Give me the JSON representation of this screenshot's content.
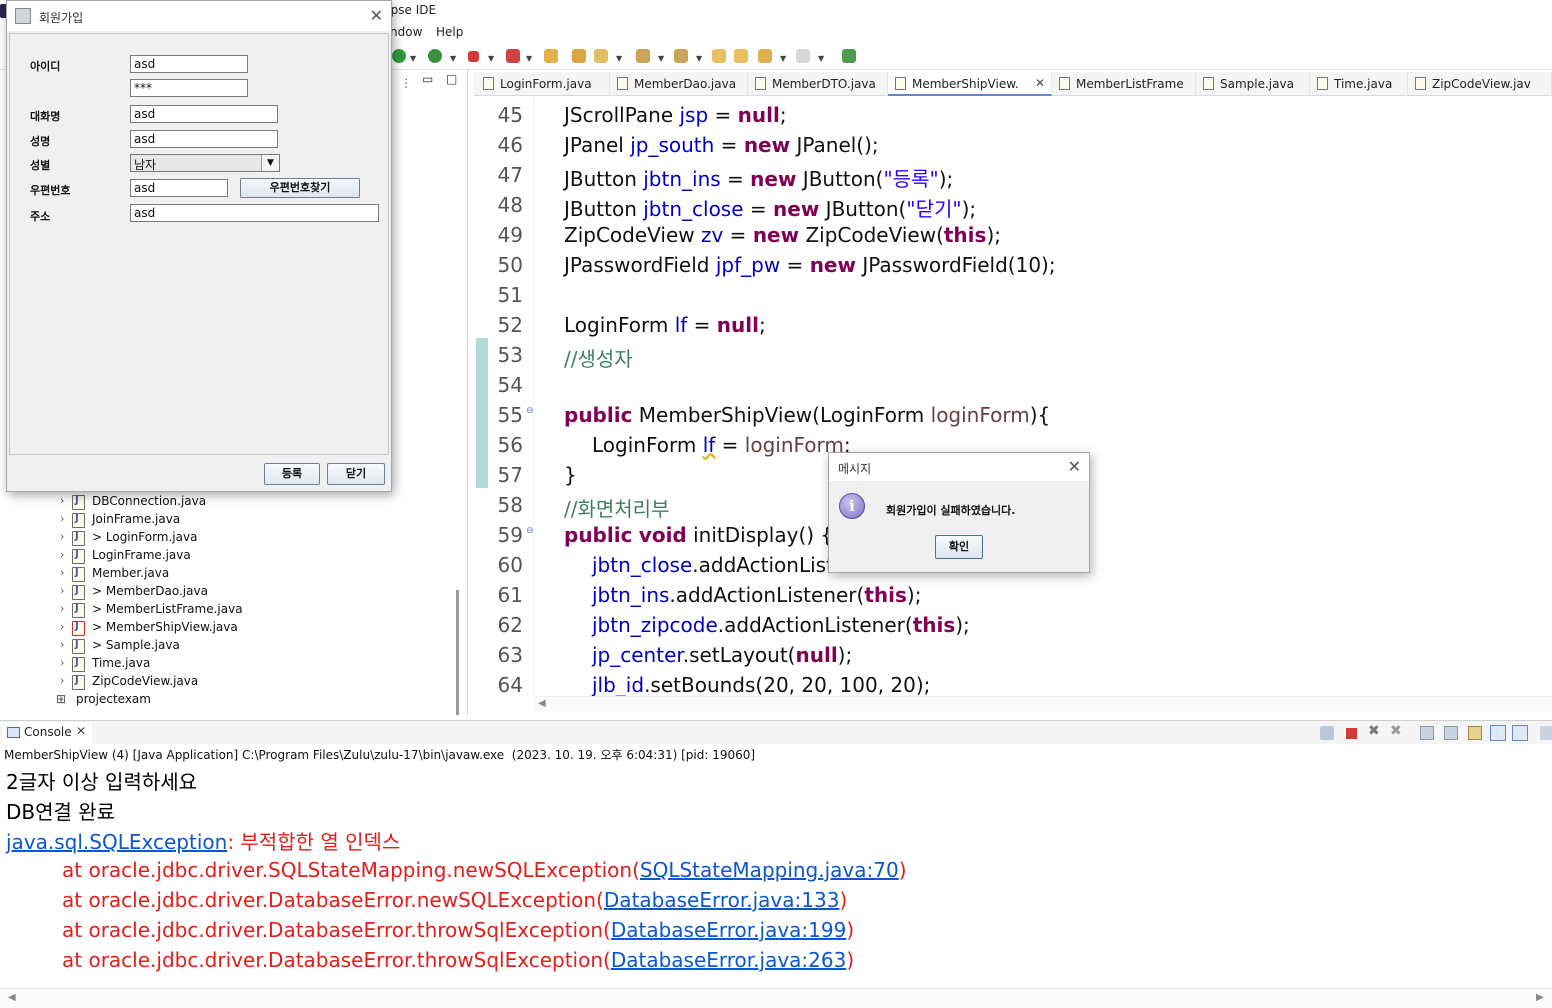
{
  "ide": {
    "title_fragment": "lipse IDE",
    "menu": [
      "ndow",
      "Help"
    ]
  },
  "explorer": {
    "items": [
      {
        "label": "DBConnection.java",
        "prefix": ""
      },
      {
        "label": "JoinFrame.java",
        "prefix": ""
      },
      {
        "label": "LoginForm.java",
        "prefix": "> "
      },
      {
        "label": "LoginFrame.java",
        "prefix": ""
      },
      {
        "label": "Member.java",
        "prefix": ""
      },
      {
        "label": "MemberDao.java",
        "prefix": "> "
      },
      {
        "label": "MemberListFrame.java",
        "prefix": "> "
      },
      {
        "label": "MemberShipView.java",
        "prefix": "> "
      },
      {
        "label": "Sample.java",
        "prefix": "> "
      },
      {
        "label": "Time.java",
        "prefix": ""
      },
      {
        "label": "ZipCodeView.java",
        "prefix": ""
      }
    ],
    "project": "projectexam"
  },
  "editor": {
    "tabs": [
      {
        "label": "LoginForm.java",
        "active": false
      },
      {
        "label": "MemberDao.java",
        "active": false
      },
      {
        "label": "MemberDTO.java",
        "active": false
      },
      {
        "label": "MemberShipView.",
        "active": true
      },
      {
        "label": "MemberListFrame",
        "active": false
      },
      {
        "label": "Sample.java",
        "active": false
      },
      {
        "label": "Time.java",
        "active": false
      },
      {
        "label": "ZipCodeView.jav",
        "active": false
      }
    ],
    "line_numbers": [
      "45",
      "46",
      "47",
      "48",
      "49",
      "50",
      "51",
      "52",
      "53",
      "54",
      "55",
      "56",
      "57",
      "58",
      "59",
      "60",
      "61",
      "62",
      "63",
      "64"
    ],
    "code": {
      "l45a": "JScrollPane ",
      "l45b": "jsp",
      "l45c": " = ",
      "l45d": "null",
      "l45e": ";",
      "l46a": "JPanel ",
      "l46b": "jp_south",
      "l46c": " = ",
      "l46d": "new",
      "l46e": " JPanel();",
      "l47a": "JButton ",
      "l47b": "jbtn_ins",
      "l47c": " = ",
      "l47d": "new",
      "l47e": " JButton(",
      "l47f": "\"등록\"",
      "l47g": ");",
      "l48a": "JButton ",
      "l48b": "jbtn_close",
      "l48c": " = ",
      "l48d": "new",
      "l48e": " JButton(",
      "l48f": "\"닫기\"",
      "l48g": ");",
      "l49a": "ZipCodeView ",
      "l49b": "zv",
      "l49c": " = ",
      "l49d": "new",
      "l49e": " ZipCodeView(",
      "l49f": "this",
      "l49g": ");",
      "l50a": "JPasswordField ",
      "l50b": "jpf_pw",
      "l50c": " = ",
      "l50d": "new",
      "l50e": " JPasswordField(10);",
      "l52a": "LoginForm ",
      "l52b": "lf",
      "l52c": " = ",
      "l52d": "null",
      "l52e": ";",
      "l53": "//생성자",
      "l55a": "public",
      "l55b": " MemberShipView(LoginForm ",
      "l55c": "loginForm",
      "l55d": "){",
      "l56a": "LoginForm ",
      "l56b": "lf",
      "l56c": " = ",
      "l56d": "loginForm",
      "l56e": ";",
      "l57": "}",
      "l58": "//화면처리부",
      "l59a": "public",
      "l59b": " ",
      "l59c": "void",
      "l59d": " initDisplay() {",
      "l60a": "jbtn_close",
      "l60b": ".addActionListe",
      "l61a": "jbtn_ins",
      "l61b": ".addActionListener(",
      "l61c": "this",
      "l61d": ");",
      "l62a": "jbtn_zipcode",
      "l62b": ".addActionListener(",
      "l62c": "this",
      "l62d": ");",
      "l63a": "jp_center",
      "l63b": ".setLayout(",
      "l63c": "null",
      "l63d": ");",
      "l64a": "jlb_id",
      "l64b": ".setBounds(20, 20, 100, 20);"
    }
  },
  "console": {
    "tab_label": "Console",
    "description": "MemberShipView (4) [Java Application] C:\\Program Files\\Zulu\\zulu-17\\bin\\javaw.exe  (2023. 10. 19. 오후 6:04:31) [pid: 19060]",
    "out1": "2글자 이상 입력하세요",
    "out2": "DB연결 완료",
    "exc_link": "java.sql.SQLException",
    "exc_msg": ": 부적합한 열 인덱스",
    "trace": [
      {
        "pre": "at oracle.jdbc.driver.SQLStateMapping.newSQLException(",
        "link": "SQLStateMapping.java:70",
        "post": ")"
      },
      {
        "pre": "at oracle.jdbc.driver.DatabaseError.newSQLException(",
        "link": "DatabaseError.java:133",
        "post": ")"
      },
      {
        "pre": "at oracle.jdbc.driver.DatabaseError.throwSqlException(",
        "link": "DatabaseError.java:199",
        "post": ")"
      },
      {
        "pre": "at oracle.jdbc.driver.DatabaseError.throwSqlException(",
        "link": "DatabaseError.java:263",
        "post": ")"
      }
    ]
  },
  "join_dialog": {
    "title": "회원가입",
    "labels": {
      "id": "아이디",
      "name_alias": "대화명",
      "name": "성명",
      "gender": "성별",
      "zipcode": "우편번호",
      "address": "주소"
    },
    "values": {
      "id": "asd",
      "password": "***",
      "nickname": "asd",
      "name": "asd",
      "gender": "남자",
      "zipcode": "asd",
      "address": "asd"
    },
    "zipcode_button": "우편번호찾기",
    "register_button": "등록",
    "close_button": "닫기"
  },
  "message_dialog": {
    "title": "메시지",
    "message": "회원가입이 실패하였습니다.",
    "ok_button": "확인"
  },
  "colors": {
    "keyword": "#7f0055",
    "field": "#0000c0",
    "string": "#2a00ff",
    "comment": "#3f7f5f",
    "error": "#e41d1d",
    "link": "#0b57d0"
  }
}
